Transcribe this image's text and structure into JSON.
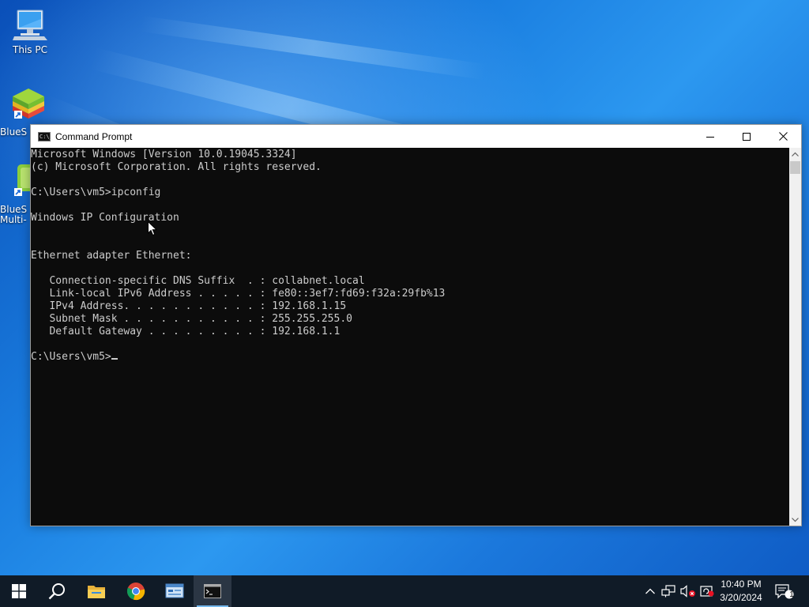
{
  "desktop": {
    "icons": [
      {
        "label": "This PC"
      },
      {
        "label": "BlueS"
      },
      {
        "label": "BlueS"
      },
      {
        "label": "Multi-"
      }
    ]
  },
  "window": {
    "title": "Command Prompt",
    "console_lines": [
      "Microsoft Windows [Version 10.0.19045.3324]",
      "(c) Microsoft Corporation. All rights reserved.",
      "",
      "C:\\Users\\vm5>ipconfig",
      "",
      "Windows IP Configuration",
      "",
      "",
      "Ethernet adapter Ethernet:",
      "",
      "   Connection-specific DNS Suffix  . : collabnet.local",
      "   Link-local IPv6 Address . . . . . : fe80::3ef7:fd69:f32a:29fb%13",
      "   IPv4 Address. . . . . . . . . . . : 192.168.1.15",
      "   Subnet Mask . . . . . . . . . . . : 255.255.255.0",
      "   Default Gateway . . . . . . . . . : 192.168.1.1",
      "",
      "C:\\Users\\vm5>"
    ]
  },
  "taskbar": {
    "apps": [
      {
        "name": "windows-start"
      },
      {
        "name": "search"
      },
      {
        "name": "file-explorer"
      },
      {
        "name": "chrome"
      },
      {
        "name": "control-panel"
      },
      {
        "name": "command-prompt"
      }
    ],
    "clock": {
      "time": "10:40 PM",
      "date": "3/20/2024"
    },
    "notification_count": "1"
  },
  "colors": {
    "console_bg": "#0c0c0c",
    "console_fg": "#cccccc",
    "taskbar_bg": "#101b27",
    "accent": "#76b9ed"
  }
}
